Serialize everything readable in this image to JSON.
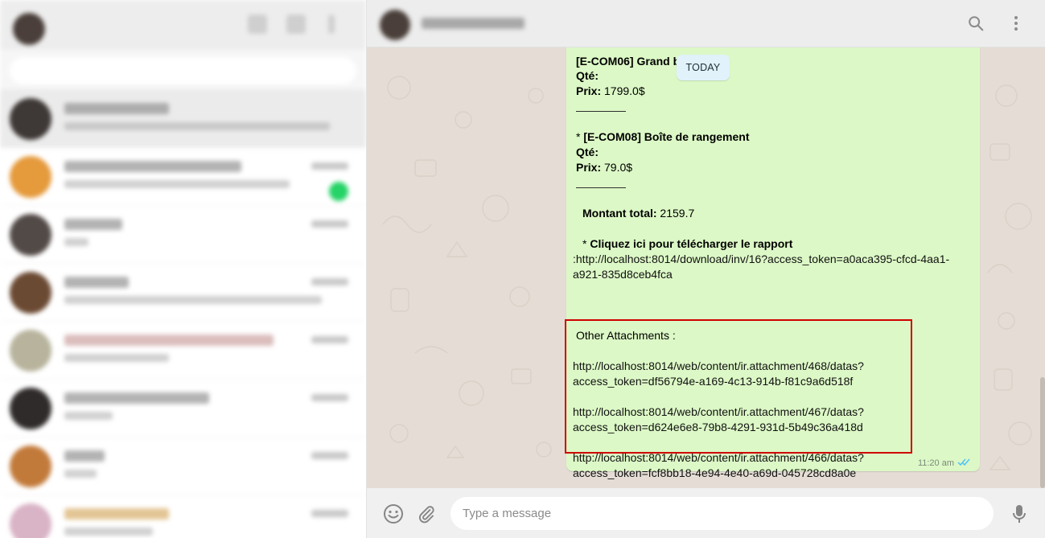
{
  "right_header": {
    "search_icon": "search-icon",
    "menu_icon": "vertical-dots-menu-icon"
  },
  "date_badge": "TODAY",
  "message": {
    "partial_item_title": "[E-COM06] Grand bureau",
    "qty_label": "Qté:",
    "price_label": "Prix:",
    "item1_price": "1799.0$",
    "item2_prefix": "* ",
    "item2_title": "[E-COM08] Boîte de rangement",
    "item2_price": "79.0$",
    "total_label": "Montant total:",
    "total_value": "2159.7",
    "download_prefix": "* ",
    "download_label": "Cliquez ici pour télécharger le rapport",
    "download_link_line1": ":http://localhost:8014/download/inv/16?access_token=a0aca395-cfcd-4aa1-",
    "download_link_line2": "a921-835d8ceb4fca",
    "attachments_label": "Other Attachments :",
    "attachments": [
      {
        "line1": "http://localhost:8014/web/content/ir.attachment/468/datas?",
        "line2": "access_token=df56794e-a169-4c13-914b-f81c9a6d518f"
      },
      {
        "line1": "http://localhost:8014/web/content/ir.attachment/467/datas?",
        "line2": "access_token=d624e6e8-79b8-4291-931d-5b49c36a418d"
      },
      {
        "line1": "http://localhost:8014/web/content/ir.attachment/466/datas?",
        "line2": "access_token=fcf8bb18-4e94-4e40-a69d-045728cd8a0e"
      }
    ],
    "time": "11:20 am",
    "status_icon": "double-check-icon"
  },
  "footer": {
    "emoji_icon": "emoji-icon",
    "attach_icon": "paperclip-icon",
    "input_placeholder": "Type a message",
    "mic_icon": "microphone-icon"
  },
  "colors": {
    "bubble": "#dcf8c6",
    "wallpaper": "#e5ddd5",
    "date_badge": "#e1f2fb",
    "highlight_border": "#d00000",
    "read_ticks": "#4fc3f7",
    "unread_badge": "#25d366"
  }
}
